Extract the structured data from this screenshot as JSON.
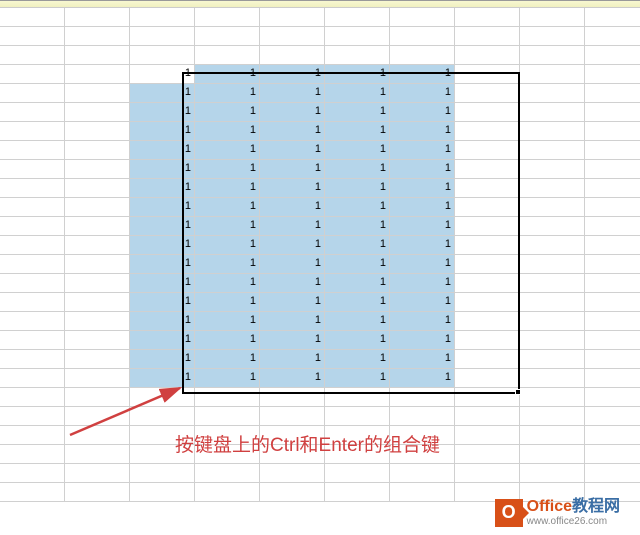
{
  "grid": {
    "totalCols": 10,
    "totalRows": 26,
    "selection": {
      "startRow": 3,
      "endRow": 19,
      "startCol": 2,
      "endCol": 6,
      "activeRow": 3,
      "activeCol": 2,
      "value": "1"
    }
  },
  "annotation": {
    "text": "按键盘上的Ctrl和Enter的组合键"
  },
  "watermark": {
    "logo": "O",
    "brandPrefix": "Office",
    "brandSuffix": "教程网",
    "url": "www.office26.com"
  }
}
